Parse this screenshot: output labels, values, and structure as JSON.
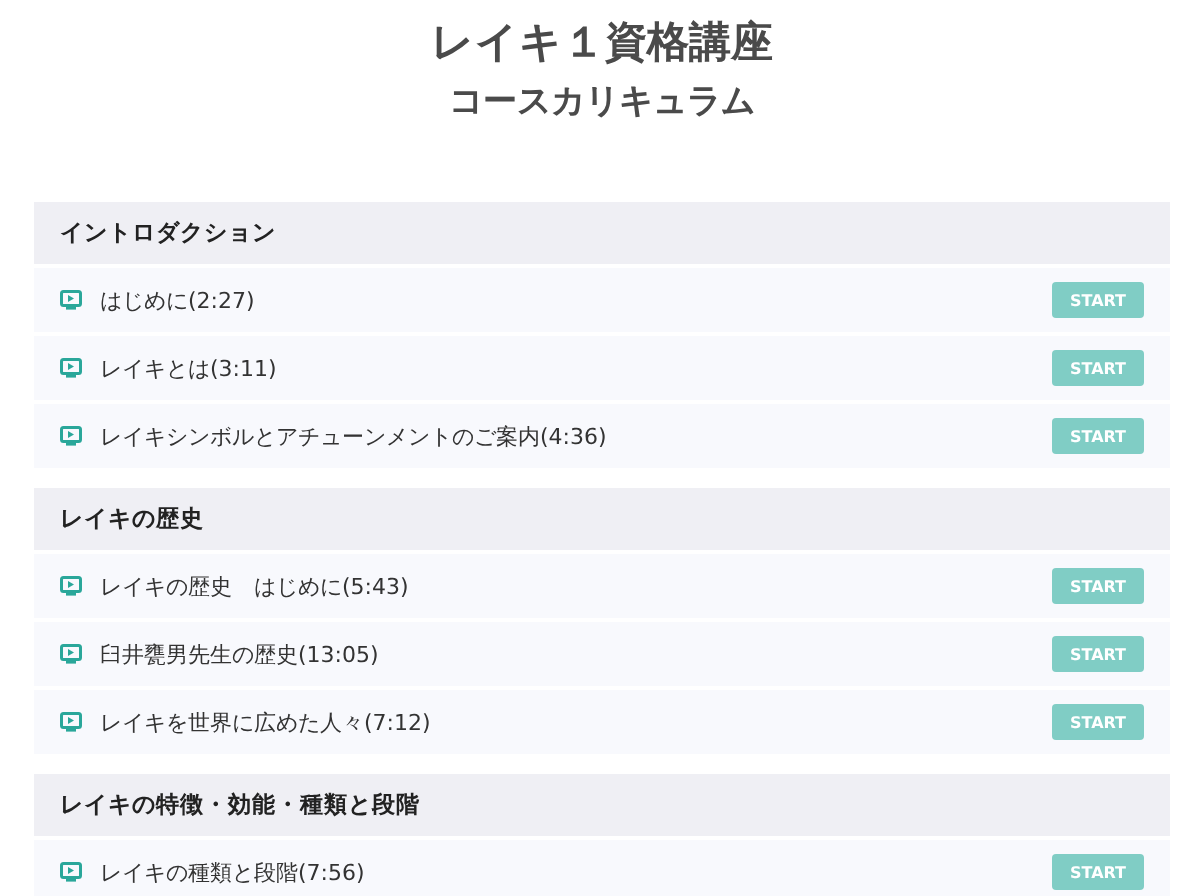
{
  "title": "レイキ１資格講座",
  "subtitle": "コースカリキュラム",
  "sections": [
    {
      "title": "イントロダクション",
      "lessons": [
        {
          "title": "はじめに(2:27)",
          "button": "START"
        },
        {
          "title": "レイキとは(3:11)",
          "button": "START"
        },
        {
          "title": "レイキシンボルとアチューンメントのご案内(4:36)",
          "button": "START"
        }
      ]
    },
    {
      "title": "レイキの歴史",
      "lessons": [
        {
          "title": "レイキの歴史　はじめに(5:43)",
          "button": "START"
        },
        {
          "title": "臼井甕男先生の歴史(13:05)",
          "button": "START"
        },
        {
          "title": "レイキを世界に広めた人々(7:12)",
          "button": "START"
        }
      ]
    },
    {
      "title": "レイキの特徴・効能・種類と段階",
      "lessons": [
        {
          "title": "レイキの種類と段階(7:56)",
          "button": "START"
        }
      ]
    }
  ]
}
